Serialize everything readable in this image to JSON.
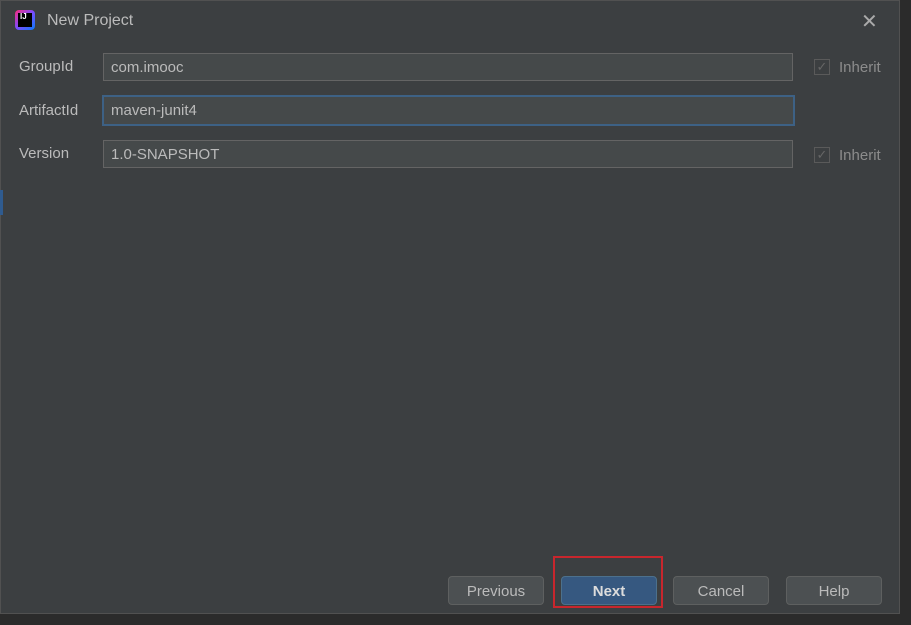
{
  "window": {
    "title": "New Project",
    "icon": "intellij-idea-icon",
    "close_icon": "close-icon"
  },
  "form": {
    "group_id": {
      "label": "GroupId",
      "value": "com.imooc",
      "inherit_label": "Inherit",
      "inherit_checked": true
    },
    "artifact_id": {
      "label": "ArtifactId",
      "value": "maven-junit4"
    },
    "version": {
      "label": "Version",
      "value": "1.0-SNAPSHOT",
      "inherit_label": "Inherit",
      "inherit_checked": true
    }
  },
  "buttons": {
    "previous": "Previous",
    "next": "Next",
    "cancel": "Cancel",
    "help": "Help"
  },
  "colors": {
    "highlight": "#c8262d",
    "primary": "#365880"
  }
}
